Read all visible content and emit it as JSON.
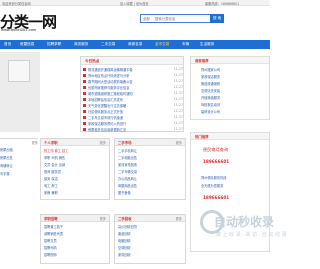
{
  "topbar": {
    "left": "欢迎来到分类信息网",
    "mid": "加入收藏 | 设为首页",
    "right": "客服热线：189666601"
  },
  "header": {
    "logo_text": "分类一网",
    "logo_url": "www.fenlei001.com",
    "search_select": "全部",
    "search_placeholder": "搜索分类信息",
    "search_button": "搜 索"
  },
  "nav": {
    "items": [
      "首页",
      "房屋信息",
      "招聘求职",
      "商务服务",
      "二手交易",
      "商家名录",
      "金币交易",
      "车辆",
      "生活服务"
    ],
    "hot_index": 6
  },
  "news": {
    "title": "今日热点",
    "items": [
      {
        "text": "物流通道开通保障运输畅通平稳",
        "date": "11-27"
      },
      {
        "text": "郑州地区热点行情综述与分析",
        "date": "11-27"
      },
      {
        "text": "春节期间大型活动提前筹备公告",
        "date": "11-27"
      },
      {
        "text": "优质商家推荐与服务评比信息",
        "date": "11-27"
      },
      {
        "text": "城市道路维修施工路段临时通知",
        "date": "11-27"
      },
      {
        "text": "本地招聘会信息汇总发布",
        "date": "11-27"
      },
      {
        "text": "天气变化提醒出行注意保暖",
        "date": "11-27"
      },
      {
        "text": "社区便民服务点正式开放",
        "date": "11-27"
      },
      {
        "text": "二手车交易市场行情速递",
        "date": "11-27"
      },
      {
        "text": "家政保洁服务预约火热进行",
        "date": "11-27"
      },
      {
        "text": "房屋租赁信息最新更新汇总",
        "date": "11-27"
      }
    ]
  },
  "ads": {
    "box1_title": "商家推荐",
    "box1_lines": [
      "郑州搬家公司",
      "家政保洁服务",
      "管道疏通维修",
      "空调清洗安装",
      "开锁换锁服务",
      "驾校报名培训",
      "装修设计公司"
    ],
    "box2_title": "热门推荐",
    "box2_big": "便民电话查询",
    "box2_tel1": "189666601",
    "box2_line": "郑州便民服务热线",
    "box2_line2": "全天候为您服务",
    "box2_tel2": "189666601"
  },
  "sections": [
    {
      "title": "个人求职",
      "more": "更多",
      "lines": [
        "找工作 普工 技工",
        "求职 司机 销售",
        "文员 会计 出纳",
        "厨师 服务员",
        "保安 保洁",
        "电工 焊工",
        "家教 兼职"
      ]
    },
    {
      "title": "二手市场",
      "more": "更多",
      "lines": [
        "二手手机转让",
        "二手电脑出售",
        "家具家电回收",
        "二手车辆交易",
        "办公用品转让",
        "母婴用品出售",
        "图书音像"
      ]
    },
    {
      "title": "求职招聘",
      "more": "更多",
      "lines": [
        "招聘普工若干",
        "诚聘销售代表",
        "招聘文员",
        "招聘司机",
        "招聘厨师"
      ]
    },
    {
      "title": "二手回收",
      "more": "更多",
      "lines": [
        "高价回收旧货",
        "废品回收",
        "电脑回收",
        "空调回收",
        "家具回收"
      ]
    }
  ],
  "stub_left": {
    "lines": [
      "房屋出租",
      "房屋出售",
      "商铺转让",
      "写字楼"
    ],
    "more": "更多"
  },
  "watermark": {
    "text": "自动秒收录",
    "sub": "数 上 收 录 · 来 访 · 自 动 收 录"
  }
}
